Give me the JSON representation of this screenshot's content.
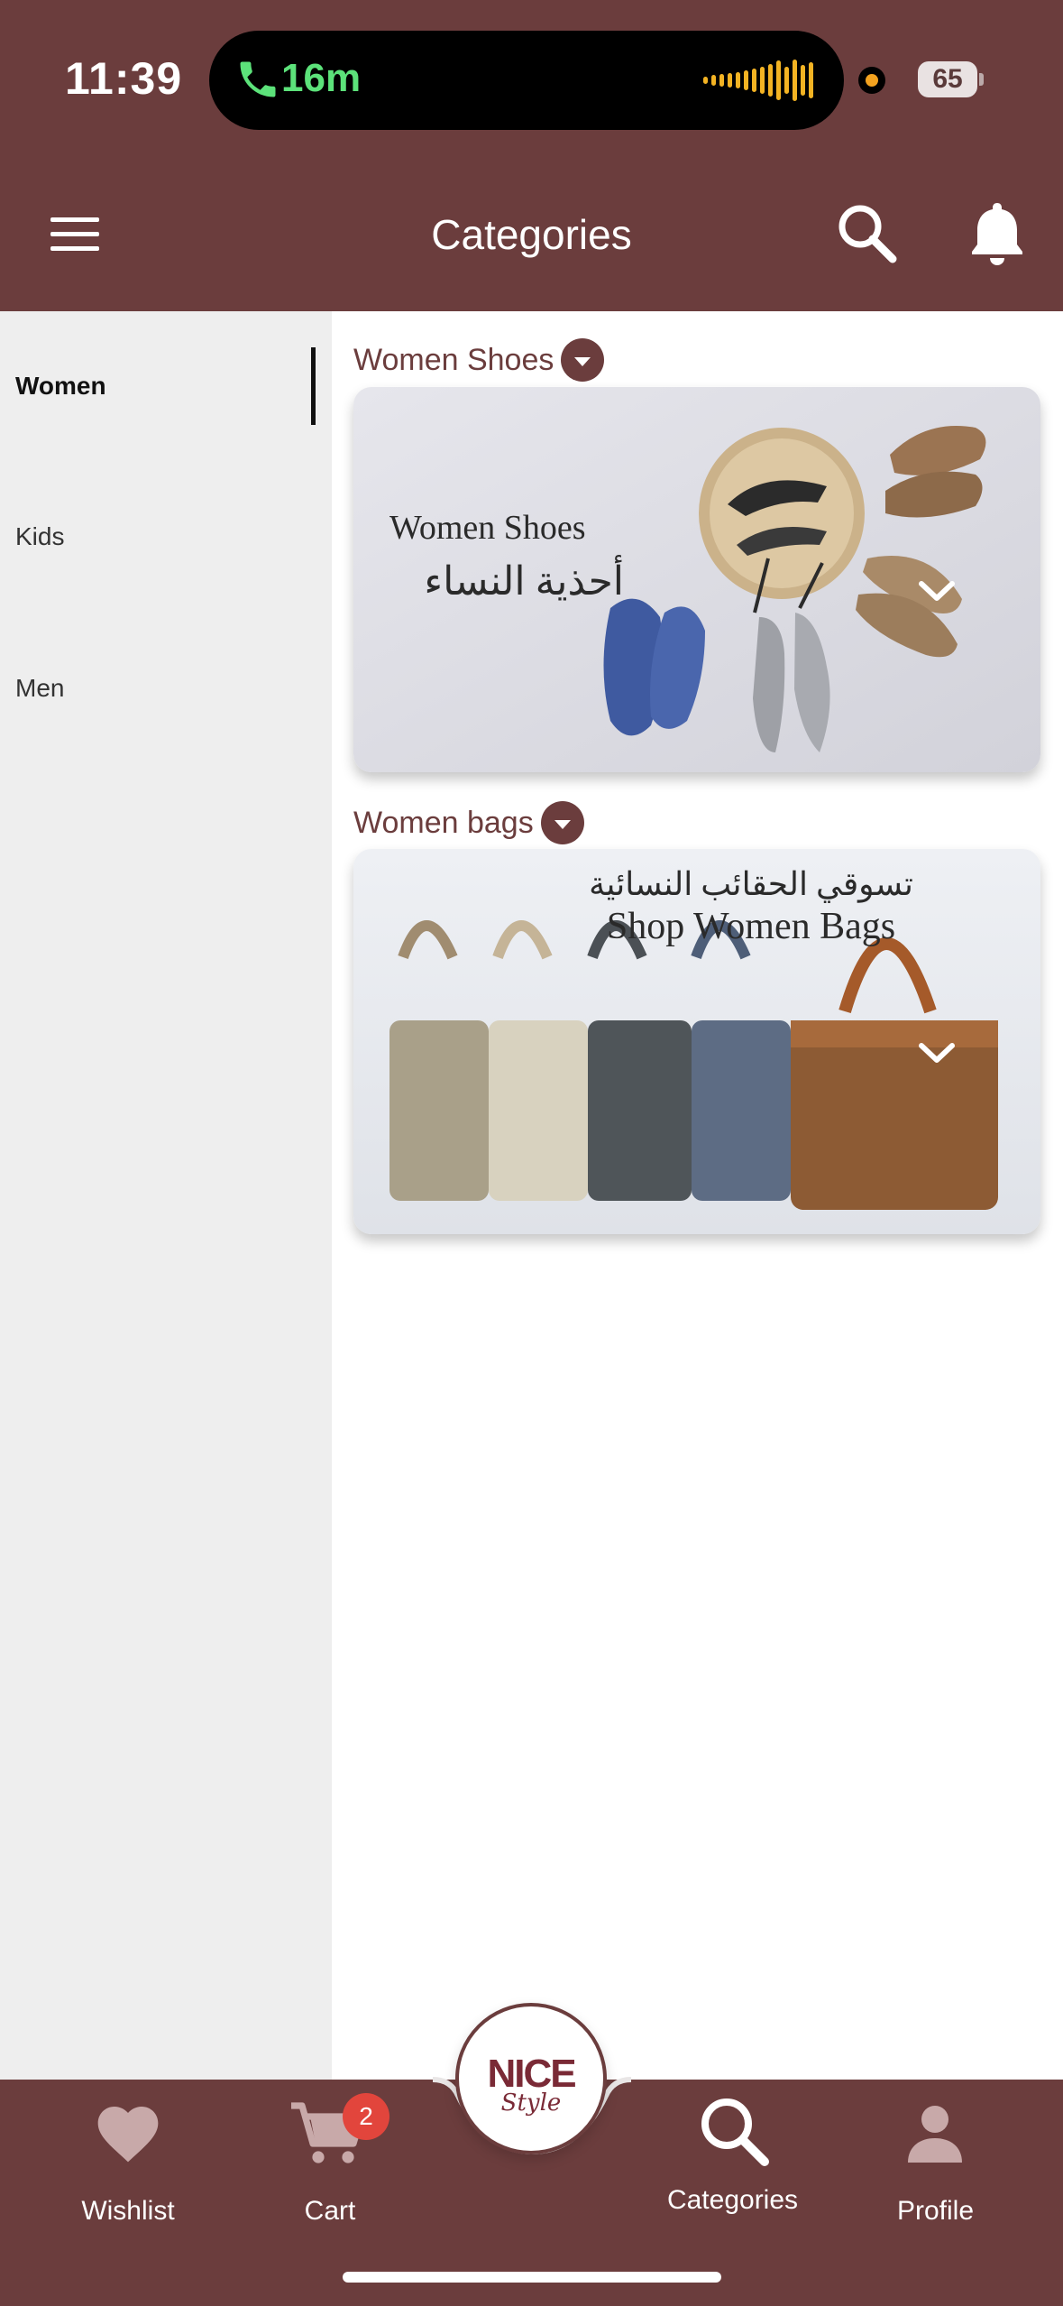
{
  "status_bar": {
    "time": "11:39",
    "call_duration": "16m",
    "battery": "65"
  },
  "header": {
    "title": "Categories"
  },
  "sidebar": {
    "items": [
      {
        "label": "Women",
        "active": true
      },
      {
        "label": "Kids",
        "active": false
      },
      {
        "label": "Men",
        "active": false
      }
    ]
  },
  "sections": [
    {
      "title": "Women Shoes",
      "banner_en": "Women Shoes",
      "banner_ar": "أحذية النساء"
    },
    {
      "title": "Women bags",
      "banner_en": "Shop Women Bags",
      "banner_ar": "تسوقي الحقائب النسائية"
    }
  ],
  "bottom_nav": {
    "wishlist": "Wishlist",
    "cart": "Cart",
    "cart_count": "2",
    "categories": "Categories",
    "profile": "Profile",
    "logo_main": "NICE",
    "logo_script": "Style"
  },
  "colors": {
    "brand": "#6b3d3d",
    "sidebar_bg": "#eeeeee",
    "badge": "#e2453c",
    "call_green": "#5ce27a"
  }
}
